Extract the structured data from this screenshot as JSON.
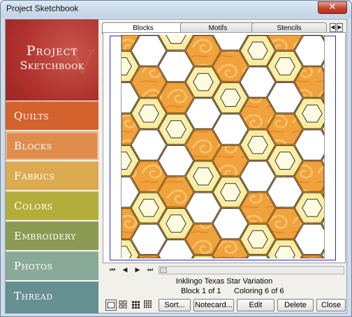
{
  "window": {
    "title": "Project Sketchbook",
    "close_glyph": "✕"
  },
  "brand": {
    "line1": "Project",
    "line2": "Sketchbook",
    "watermark_glyph": "V"
  },
  "sidebar": {
    "items": [
      {
        "label": "Quilts",
        "color": "#d4622e"
      },
      {
        "label": "Blocks",
        "color": "#e08c4c",
        "active": true
      },
      {
        "label": "Fabrics",
        "color": "#dcaa50"
      },
      {
        "label": "Colors",
        "color": "#b3ae3b"
      },
      {
        "label": "Embroidery",
        "color": "#8c9a53"
      },
      {
        "label": "Photos",
        "color": "#8aaa98"
      },
      {
        "label": "Thread",
        "color": "#658f91"
      }
    ]
  },
  "tabs": [
    {
      "label": "Blocks",
      "active": true
    },
    {
      "label": "Motifs",
      "active": false
    },
    {
      "label": "Stencils",
      "active": false
    }
  ],
  "tab_scroll": {
    "left_glyph": "◀",
    "right_glyph": "▶"
  },
  "navigation": {
    "first_glyph": "⏮",
    "prev_glyph": "◀",
    "next_glyph": "▶",
    "last_glyph": "⏭"
  },
  "block_info": {
    "name": "Inklingo Texas Star Variation",
    "position": "Block 1 of 1",
    "coloring": "Coloring 6 of 6"
  },
  "toolbar": {
    "view_modes": [
      "single-view",
      "grid-2x2-view",
      "grid-3x3-view",
      "grid-4x4-view"
    ],
    "sort_label": "Sort...",
    "notecard_label": "Notecard...",
    "edit_label": "Edit",
    "delete_label": "Delete",
    "close_label": "Close"
  },
  "colors": {
    "orange_fabric": "#f0a23c",
    "light_yellow": "#fbef9a",
    "white_hex": "#ffffff",
    "frame_blue": "#2a2acc"
  }
}
